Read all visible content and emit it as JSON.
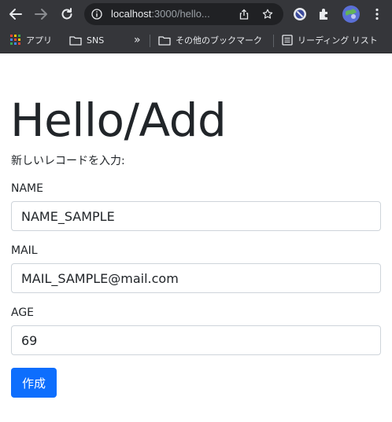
{
  "browser": {
    "url_host": "localhost",
    "url_rest": ":3000/hello...",
    "bookmarks": {
      "apps": "アプリ",
      "sns": "SNS",
      "more": "»",
      "other": "その他のブックマーク",
      "reading_list": "リーディング リスト"
    }
  },
  "page": {
    "title": "Hello/Add",
    "subtitle": "新しいレコードを入力:",
    "fields": {
      "name_label": "NAME",
      "name_value": "NAME_SAMPLE",
      "mail_label": "MAIL",
      "mail_value": "MAIL_SAMPLE@mail.com",
      "age_label": "AGE",
      "age_value": "69"
    },
    "submit_label": "作成"
  },
  "colors": {
    "primary": "#0d6efd",
    "chrome": "#35363a",
    "text": "#212529"
  }
}
